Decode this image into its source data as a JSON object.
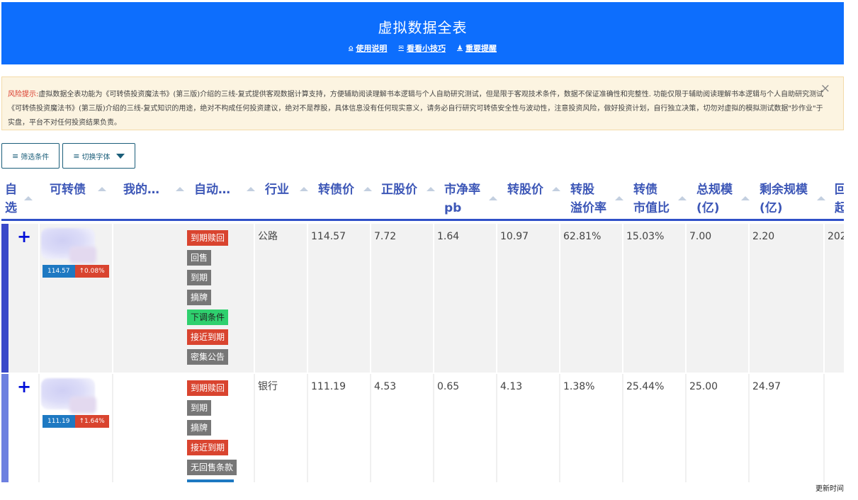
{
  "header": {
    "title": "虚拟数据全表",
    "links": [
      {
        "icon": "home-icon",
        "glyph": "⌂",
        "label": "使用说明"
      },
      {
        "icon": "envelope-icon",
        "glyph": "✉",
        "label": "看看小技巧"
      },
      {
        "icon": "user-icon",
        "glyph": "♟",
        "label": "重要提醒"
      }
    ]
  },
  "warning": {
    "lead": "风险提示:",
    "text": "虚拟数据全表功能为《可转债投资魔法书》(第三版)介绍的三线-复式提供客观数据计算支持，方便辅助阅读理解书本逻辑与个人自助研究测试，但是限于客观技术条件，数据不保证准确性和完整性. 功能仅限于辅助阅读理解书本逻辑与个人自助研究测试《可转债投资魔法书》(第三版)介绍的三线-复式知识的用途，绝对不构成任何投资建议，绝对不是荐股，具体信息没有任何现实意义，请务必自行研究可转债安全性与波动性，注意投资风险，做好投资计划，自行独立决策，切勿对虚拟的模拟测试数据\"抄作业\"于实盘，平台不对任何投资结果负责。",
    "close": "×"
  },
  "toolbar": {
    "filter_icon": "≡",
    "filter_label": "筛选条件",
    "font_icon": "≡",
    "font_label": "切换字体"
  },
  "columns": [
    {
      "id": "select",
      "line1": "自",
      "line2": "选"
    },
    {
      "id": "name",
      "line1": "可转债",
      "line2": ""
    },
    {
      "id": "mine",
      "line1": "我的…",
      "line2": ""
    },
    {
      "id": "auto",
      "line1": "自动…",
      "line2": ""
    },
    {
      "id": "industry",
      "line1": "行业",
      "line2": ""
    },
    {
      "id": "bond_price",
      "line1": "转债价",
      "line2": ""
    },
    {
      "id": "stock_price",
      "line1": "正股价",
      "line2": ""
    },
    {
      "id": "pb",
      "line1": "市净率",
      "line2": "pb"
    },
    {
      "id": "conv_price",
      "line1": "转股价",
      "line2": ""
    },
    {
      "id": "premium",
      "line1": "转股",
      "line2": "溢价率"
    },
    {
      "id": "mcap_ratio",
      "line1": "转债",
      "line2": "市值比"
    },
    {
      "id": "total_size",
      "line1": "总规模",
      "line2": "(亿)"
    },
    {
      "id": "remain_size",
      "line1": "剩余规模",
      "line2": "(亿)"
    },
    {
      "id": "next",
      "line1": "回",
      "line2": "起"
    }
  ],
  "rows": [
    {
      "plus": "+",
      "price_badge": "114.57",
      "change_badge": "↑0.08%",
      "tags": [
        {
          "label": "到期赎回",
          "color": "red"
        },
        {
          "label": "回售",
          "color": "gray"
        },
        {
          "label": "到期",
          "color": "gray"
        },
        {
          "label": "摘牌",
          "color": "gray"
        },
        {
          "label": "下调条件",
          "color": "green"
        },
        {
          "label": "接近到期",
          "color": "red"
        },
        {
          "label": "密集公告",
          "color": "gray"
        }
      ],
      "industry": "公路",
      "bond_price": "114.57",
      "stock_price": "7.72",
      "pb": "1.64",
      "conv_price": "10.97",
      "premium": "62.81%",
      "mcap_ratio": "15.03%",
      "total_size": "7.00",
      "remain_size": "2.20",
      "next": "202"
    },
    {
      "plus": "+",
      "price_badge": "111.19",
      "change_badge": "↑1.64%",
      "tags": [
        {
          "label": "到期赎回",
          "color": "red"
        },
        {
          "label": "到期",
          "color": "gray"
        },
        {
          "label": "摘牌",
          "color": "gray"
        },
        {
          "label": "接近到期",
          "color": "red"
        },
        {
          "label": "无回售条款",
          "color": "gray"
        }
      ],
      "industry": "银行",
      "bond_price": "111.19",
      "stock_price": "4.53",
      "pb": "0.65",
      "conv_price": "4.13",
      "premium": "1.38%",
      "mcap_ratio": "25.44%",
      "total_size": "25.00",
      "remain_size": "24.97",
      "next": ""
    }
  ],
  "footer": {
    "update_label": "更新时间"
  },
  "colors": {
    "header_bg": "#0d6efd",
    "column_header": "#3d57b7",
    "tag_red": "#d9442f",
    "tag_gray": "#777777",
    "tag_green": "#2fd06e",
    "badge_blue": "#1e79c2"
  }
}
